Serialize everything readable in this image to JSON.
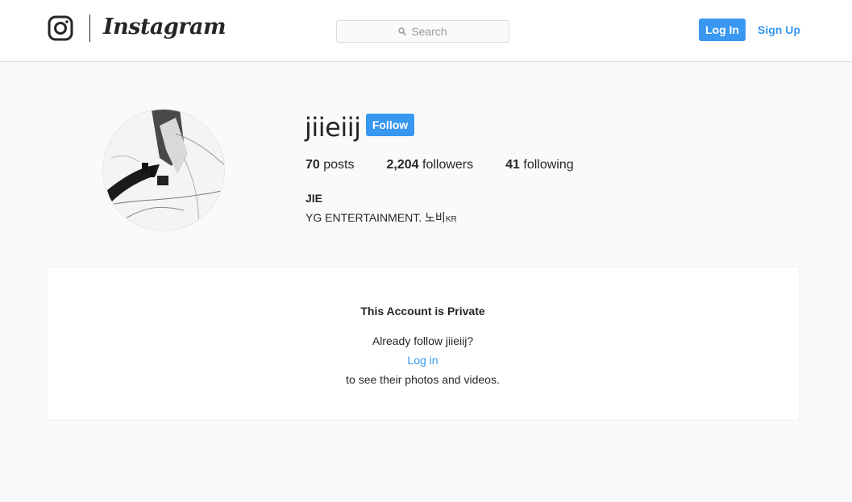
{
  "nav": {
    "brand": "Instagram",
    "search_placeholder": "Search",
    "login_label": "Log In",
    "signup_label": "Sign Up",
    "accent_color": "#3897f0"
  },
  "profile": {
    "username": "jiieiij",
    "follow_label": "Follow",
    "stats": [
      {
        "count": "70",
        "label": "posts"
      },
      {
        "count": "2,204",
        "label": "followers"
      },
      {
        "count": "41",
        "label": "following"
      }
    ],
    "full_name": "JIE",
    "bio": "YG ENTERTAINMENT. 노비",
    "bio_flag": "KR"
  },
  "private_card": {
    "title": "This Account is Private",
    "already_follow": "Already follow jiieiij?",
    "login_link": "Log in",
    "to_see": "to see their photos and videos."
  },
  "icons": {
    "logo": "instagram-glyph-icon",
    "search": "search-icon"
  }
}
